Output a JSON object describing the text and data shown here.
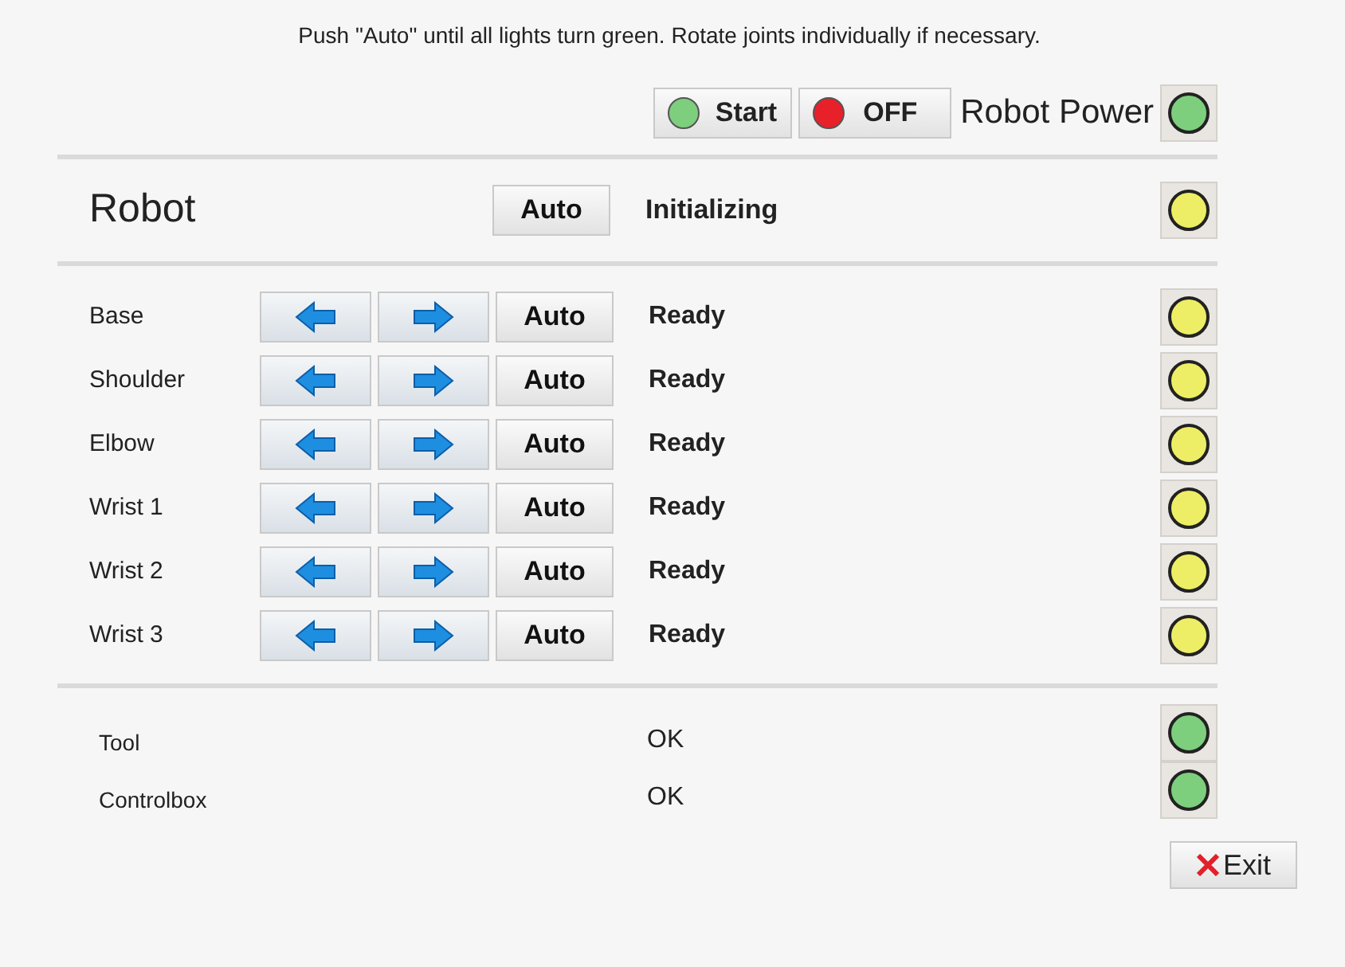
{
  "instruction": "Push \"Auto\" until all lights turn green. Rotate joints individually if necessary.",
  "power": {
    "start_button": {
      "label": "Start",
      "color": "#7dcf7d"
    },
    "off_button": {
      "label": "OFF",
      "color": "#e8202a"
    },
    "label": "Robot Power",
    "color": "#7dcf7d"
  },
  "robot": {
    "label": "Robot",
    "auto_button": "Auto",
    "status": "Initializing",
    "color": "#eeee66"
  },
  "joints": [
    {
      "name": "Base",
      "auto_button": "Auto",
      "status": "Ready",
      "color": "#eeee66"
    },
    {
      "name": "Shoulder",
      "auto_button": "Auto",
      "status": "Ready",
      "color": "#eeee66"
    },
    {
      "name": "Elbow",
      "auto_button": "Auto",
      "status": "Ready",
      "color": "#eeee66"
    },
    {
      "name": "Wrist 1",
      "auto_button": "Auto",
      "status": "Ready",
      "color": "#eeee66"
    },
    {
      "name": "Wrist 2",
      "auto_button": "Auto",
      "status": "Ready",
      "color": "#eeee66"
    },
    {
      "name": "Wrist 3",
      "auto_button": "Auto",
      "status": "Ready",
      "color": "#eeee66"
    }
  ],
  "devices": [
    {
      "name": "Tool",
      "status": "OK",
      "color": "#7dcf7d"
    },
    {
      "name": "Controlbox",
      "status": "OK",
      "color": "#7dcf7d"
    }
  ],
  "exit_button": "Exit"
}
